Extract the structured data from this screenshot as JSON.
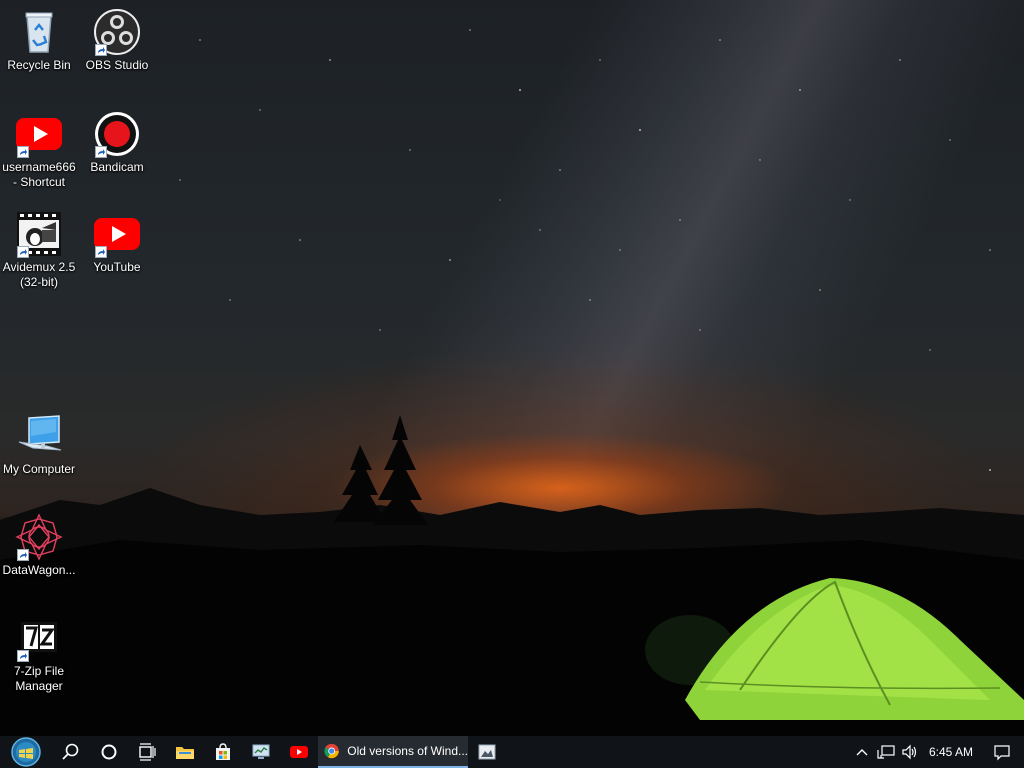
{
  "desktop": {
    "icons": [
      {
        "label": "Recycle Bin",
        "icon": "recycle-bin-icon"
      },
      {
        "label": "OBS Studio",
        "icon": "obs-icon"
      },
      {
        "label": "username666\n- Shortcut",
        "icon": "youtube-icon"
      },
      {
        "label": "Bandicam",
        "icon": "bandicam-icon"
      },
      {
        "label": "Avidemux 2.5\n(32-bit)",
        "icon": "avidemux-icon"
      },
      {
        "label": "YouTube",
        "icon": "youtube-icon"
      },
      {
        "label": "My Computer",
        "icon": "computer-icon"
      },
      {
        "label": "DataWagon...",
        "icon": "datawagon-icon"
      },
      {
        "label": "7-Zip File\nManager",
        "icon": "7zip-icon"
      }
    ]
  },
  "taskbar": {
    "chrome_task_title": "Old versions of Wind...",
    "clock": "6:45 AM"
  },
  "colors": {
    "taskbar_bg": "#101418",
    "active_task_underline": "#7fb3e6",
    "youtube_red": "#ff0000",
    "tent_green": "#9be03a"
  }
}
